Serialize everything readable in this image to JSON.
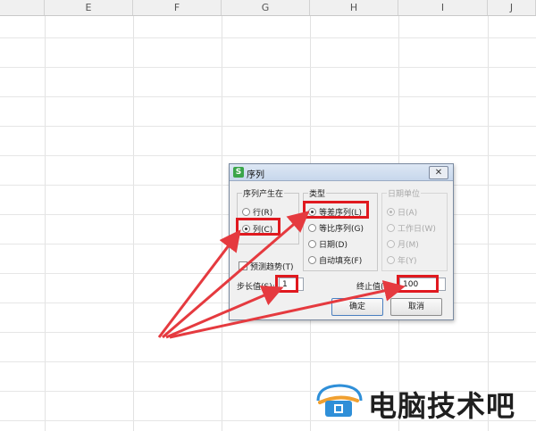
{
  "spreadsheet": {
    "columns": [
      "E",
      "F",
      "G",
      "H",
      "I",
      "J"
    ]
  },
  "dialog": {
    "title": "序列",
    "close_label": "✕",
    "series_in": {
      "label": "序列产生在",
      "options": [
        "行(R)",
        "列(C)"
      ],
      "selected": "列(C)"
    },
    "type": {
      "label": "类型",
      "options": [
        "等差序列(L)",
        "等比序列(G)",
        "日期(D)",
        "自动填充(F)"
      ],
      "selected": "等差序列(L)"
    },
    "date_unit": {
      "label": "日期单位",
      "options": [
        "日(A)",
        "工作日(W)",
        "月(M)",
        "年(Y)"
      ],
      "selected": "日(A)",
      "enabled": false
    },
    "trend": {
      "label": "预测趋势(T)",
      "checked": false
    },
    "step": {
      "label": "步长值(S):",
      "value": "1"
    },
    "stop": {
      "label": "终止值(O):",
      "value": "100"
    },
    "ok_label": "确定",
    "cancel_label": "取消"
  },
  "watermark": {
    "text": "电脑技术吧"
  },
  "colors": {
    "highlight": "#e0191f",
    "arrow": "#e53a3f",
    "watermark_blue": "#2f8fd8",
    "watermark_orange": "#f0a030"
  }
}
